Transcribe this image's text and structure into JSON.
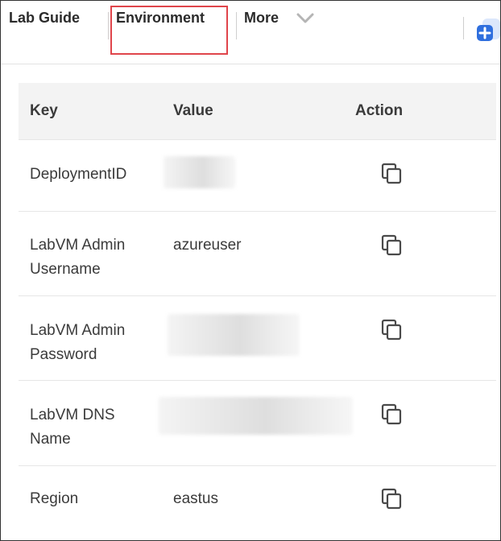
{
  "tabs": {
    "lab_guide": "Lab Guide",
    "environment": "Environment",
    "more": "More"
  },
  "icons": {
    "more_chevron": "chevron-down-icon",
    "add": "plus-icon",
    "copy": "copy-icon"
  },
  "colors": {
    "highlight_border": "#e0454b",
    "accent_blue": "#2f6fde",
    "header_bg": "#f3f3f3"
  },
  "table": {
    "columns": [
      "Key",
      "Value",
      "Action"
    ],
    "rows": [
      {
        "key": "DeploymentID",
        "value": "",
        "value_hidden": true
      },
      {
        "key": "LabVM Admin Username",
        "value": "azureuser",
        "value_hidden": false
      },
      {
        "key": "LabVM Admin Password",
        "value": "",
        "value_hidden": true
      },
      {
        "key": "LabVM DNS Name",
        "value": "",
        "value_hidden": true
      },
      {
        "key": "Region",
        "value": "eastus",
        "value_hidden": false
      }
    ]
  }
}
